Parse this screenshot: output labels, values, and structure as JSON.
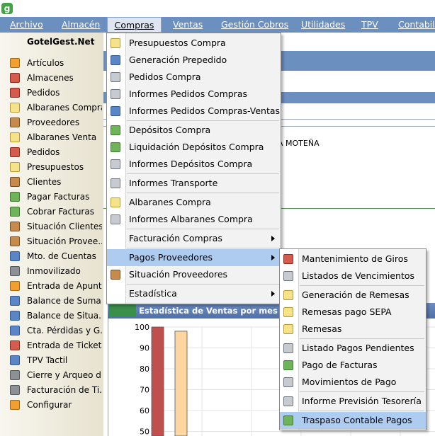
{
  "menubar": {
    "items": [
      "Archivo",
      "Almacén",
      "Compras",
      "Ventas",
      "Gestión Cobros",
      "Utilidades",
      "TPV",
      "Contabilic"
    ]
  },
  "sidebar": {
    "brand": "GotelGest.Net",
    "items": [
      {
        "label": "Artículos",
        "icon": "box-icon"
      },
      {
        "label": "Almacenes",
        "icon": "warehouse-icon"
      },
      {
        "label": "Pedidos",
        "icon": "order-icon"
      },
      {
        "label": "Albaranes Compra",
        "icon": "document-icon"
      },
      {
        "label": "Proveedores",
        "icon": "person-icon"
      },
      {
        "label": "Albaranes Venta",
        "icon": "document-icon"
      },
      {
        "label": "Pedidos",
        "icon": "order-icon"
      },
      {
        "label": "Presupuestos",
        "icon": "document-icon"
      },
      {
        "label": "Clientes",
        "icon": "person-icon"
      },
      {
        "label": "Pagar Facturas",
        "icon": "payment-icon"
      },
      {
        "label": "Cobrar Facturas",
        "icon": "payment-icon"
      },
      {
        "label": "Situación Clientes",
        "icon": "person-icon"
      },
      {
        "label": "Situación Provee...",
        "icon": "person-icon"
      },
      {
        "label": "Mto. de Cuentas",
        "icon": "database-icon"
      },
      {
        "label": "Inmovilizado",
        "icon": "building-icon"
      },
      {
        "label": "Entrada de Apunt...",
        "icon": "pencil-icon"
      },
      {
        "label": "Balance de Suma...",
        "icon": "balance-icon"
      },
      {
        "label": "Balance de Situa...",
        "icon": "balance-icon"
      },
      {
        "label": "Cta. Pérdidas y G...",
        "icon": "ledger-icon"
      },
      {
        "label": "Entrada de Tickets",
        "icon": "ticket-icon"
      },
      {
        "label": "TPV Tactil",
        "icon": "pos-terminal-icon"
      },
      {
        "label": "Cierre y Arqueo d...",
        "icon": "cash-register-icon"
      },
      {
        "label": "Facturación de Ti...",
        "icon": "invoice-icon"
      },
      {
        "label": "Configurar",
        "icon": "wrench-icon"
      }
    ]
  },
  "background": {
    "text_fragment": "A MOTEÑA",
    "chart_title": "Estadística de Ventas por mes"
  },
  "compras_menu": {
    "items": [
      {
        "label": "Presupuestos Compra",
        "icon": "document-icon"
      },
      {
        "label": "Generación Prepedido",
        "icon": "generate-icon"
      },
      {
        "label": "Pedidos Compra",
        "icon": "print-icon"
      },
      {
        "label": "Informes Pedidos Compras",
        "icon": "print-icon"
      },
      {
        "label": "Informes Pedidos Compras-Ventas",
        "icon": "network-icon"
      },
      {
        "label": "Depósitos Compra",
        "icon": "deposit-icon"
      },
      {
        "label": "Liquidación Depósitos Compra",
        "icon": "liquidation-icon"
      },
      {
        "label": "Informes Depósitos Compra",
        "icon": "print-icon"
      },
      {
        "label": "Informes Transporte",
        "icon": "print-icon"
      },
      {
        "label": "Albaranes Compra",
        "icon": "document-icon"
      },
      {
        "label": "Informes Albaranes Compra",
        "icon": "print-icon"
      },
      {
        "label": "Facturación Compras",
        "icon": "",
        "submenu": true
      },
      {
        "label": "Pagos Proveedores",
        "icon": "",
        "submenu": true,
        "highlighted": true
      },
      {
        "label": "Situación Proveedores",
        "icon": "person-icon"
      },
      {
        "label": "Estadística",
        "icon": "",
        "submenu": true
      }
    ]
  },
  "pagos_menu": {
    "items": [
      {
        "label": "Mantenimiento de Giros",
        "icon": "calendar-icon"
      },
      {
        "label": "Listados de Vencimientos",
        "icon": "print-icon"
      },
      {
        "label": "Generación de Remesas",
        "icon": "envelope-icon"
      },
      {
        "label": "Remesas pago SEPA",
        "icon": "envelope-icon"
      },
      {
        "label": "Remesas",
        "icon": "envelope-icon"
      },
      {
        "label": "Listado Pagos Pendientes",
        "icon": "list-icon"
      },
      {
        "label": "Pago de Facturas",
        "icon": "payment-icon"
      },
      {
        "label": "Movimientos de Pago",
        "icon": "print-icon"
      },
      {
        "label": "Informe Previsión Tesorería",
        "icon": "print-icon"
      },
      {
        "label": "Traspaso Contable Pagos",
        "icon": "transfer-icon",
        "highlighted": true
      }
    ]
  },
  "chart_data": {
    "type": "bar",
    "title": "Estadística de Ventas por mes",
    "y_ticks": [
      100,
      90,
      80,
      70,
      60,
      50
    ],
    "ylim": [
      50,
      100
    ],
    "series": [
      {
        "color": "#c0504d",
        "values": [
          100
        ]
      },
      {
        "color": "#fcd5a0",
        "values": [
          98
        ]
      }
    ],
    "grid": true
  }
}
